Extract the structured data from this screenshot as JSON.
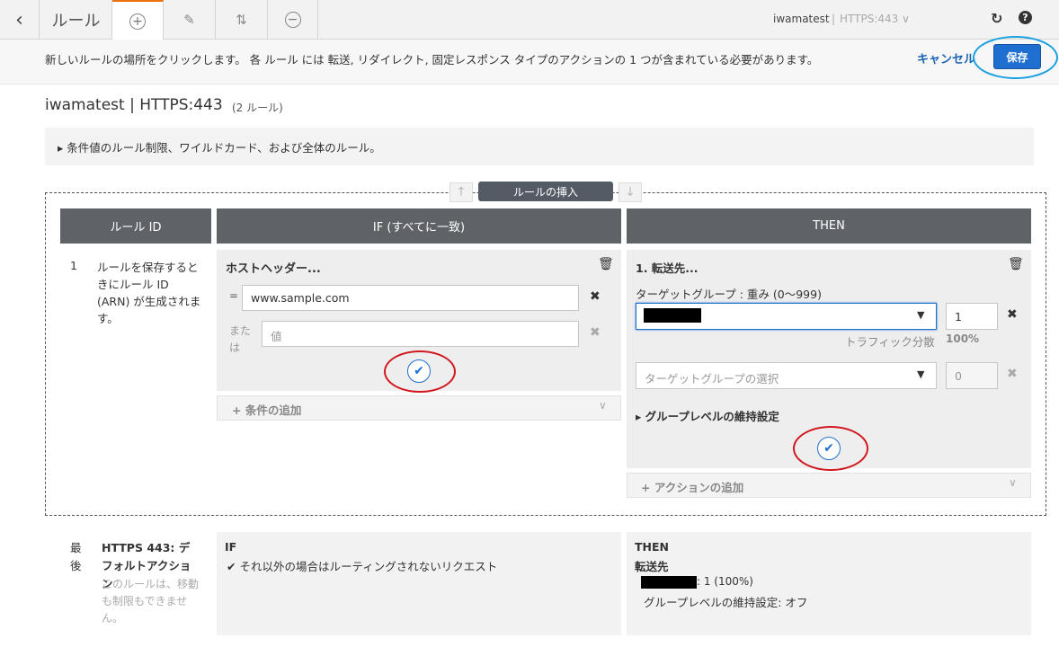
{
  "toolbar": {
    "back_icon": "chevron-left-icon",
    "title": "ルール",
    "add_icon": "plus-circle-icon",
    "edit_icon": "pencil-icon",
    "reorder_icon": "up-down-arrows-icon",
    "delete_icon": "minus-circle-icon",
    "lb_name": "iwamatest",
    "lb_separator": "|",
    "lb_port": "HTTPS:443 ∨",
    "refresh_icon": "refresh-icon",
    "help_icon": "help-icon"
  },
  "info_bar": {
    "message": "新しいルールの場所をクリックします。 各 ルール には 転送, リダイレクト, 固定レスポンス タイプのアクションの 1 つが含まれている必要があります。",
    "cancel_label": "キャンセル",
    "save_label": "保存"
  },
  "heading": {
    "title": "iwamatest | HTTPS:443",
    "rule_count": "(2 ルール)"
  },
  "expander": {
    "label": "▸ 条件値のルール制限、ワイルドカード、および全体のルール。"
  },
  "insert_bar": {
    "label": "ルールの挿入",
    "up_arrow": "↑",
    "down_arrow": "↓"
  },
  "columns": {
    "rule_id": "ルール ID",
    "if": "IF (すべてに一致)",
    "then": "THEN"
  },
  "new_rule": {
    "number": "1",
    "description": "ルールを保存するときにルール ID (ARN) が生成されます。",
    "if": {
      "title": "ホストヘッダー...",
      "operator": "=",
      "host_value": "www.sample.com",
      "or_label": "または",
      "value_placeholder": "値",
      "add_condition": "条件の追加"
    },
    "then": {
      "title": "1. 転送先...",
      "target_group_label": "ターゲットグループ : 重み (0〜999)",
      "weight": "1",
      "traffic_label": "トラフィック分散",
      "traffic_value": "100%",
      "target_group_placeholder": "ターゲットグループの選択",
      "weight2": "0",
      "stickiness": "グループレベルの維持設定",
      "add_action": "アクションの追加"
    }
  },
  "default_rule": {
    "last_label": "最後",
    "title": "HTTPS 443: デフォルトアクション",
    "description": "このルールは、移動も制限もできません。",
    "if_title": "IF",
    "if_text": "それ以外の場合はルーティングされないリクエスト",
    "then_title": "THEN",
    "forward_label": "転送先",
    "weight_text": ": 1 (100%)",
    "stickiness": "グループレベルの維持設定: オフ"
  },
  "colors": {
    "accent_tab": "#ec7211",
    "save_button": "#1f6fd0",
    "annotation_red": "#d0171e",
    "annotation_blue": "#1aa0e0"
  }
}
